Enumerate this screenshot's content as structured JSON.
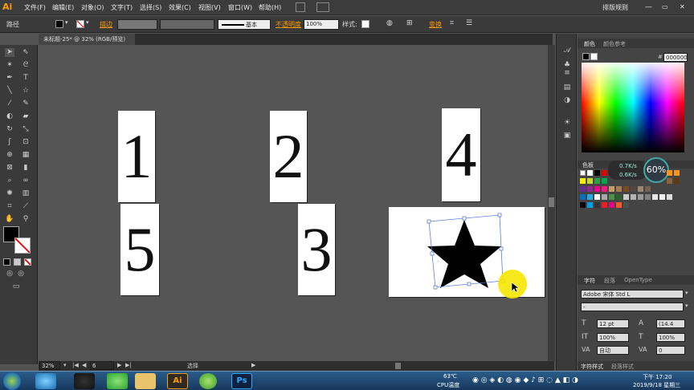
{
  "app": {
    "logo": "Ai",
    "workspace": "排版规则"
  },
  "menu": [
    "文件(F)",
    "编辑(E)",
    "对象(O)",
    "文字(T)",
    "选择(S)",
    "效果(C)",
    "视图(V)",
    "窗口(W)",
    "帮助(H)"
  ],
  "control": {
    "selection_label": "路径",
    "stroke_label": "描边",
    "stroke_style": "基本",
    "opacity_label": "不透明度",
    "opacity_value": "100%",
    "style_label": "样式:",
    "transform_label": "变换"
  },
  "document": {
    "tab": "未标题-25* @ 32% (RGB/预览)"
  },
  "cards": [
    "1",
    "2",
    "4",
    "5",
    "3"
  ],
  "statusbar": {
    "zoom": "32%",
    "page": "6",
    "tool": "选择"
  },
  "panels": {
    "color_tab": "颜色",
    "color_guide_tab": "颜色参考",
    "hex": "000000",
    "swatches_tab": "色板",
    "speed_up": "0.7K/s",
    "speed_down": "0.6K/s",
    "cpu_pct": "60%",
    "char_tab": "字符",
    "para_tab": "段落",
    "opentype_tab": "OpenType",
    "font_family": "Adobe 宋体 Std L",
    "font_style": "-",
    "font_size": "12 pt",
    "leading": "(14.4",
    "hscale": "100%",
    "vscale": "100%",
    "kerning": "自动",
    "tracking": "0",
    "char_style_tab": "字符样式",
    "para_style_tab": "段落样式"
  },
  "taskbar": {
    "temp": "63℃",
    "temp_label": "CPU温度",
    "time": "下午 17:20",
    "date": "2019/9/18 星期三",
    "ai_label": "Ai",
    "ps_label": "Ps"
  },
  "colors": {
    "accent": "#ff9a00",
    "canvas": "#535353",
    "pointer": "#f5e600"
  }
}
